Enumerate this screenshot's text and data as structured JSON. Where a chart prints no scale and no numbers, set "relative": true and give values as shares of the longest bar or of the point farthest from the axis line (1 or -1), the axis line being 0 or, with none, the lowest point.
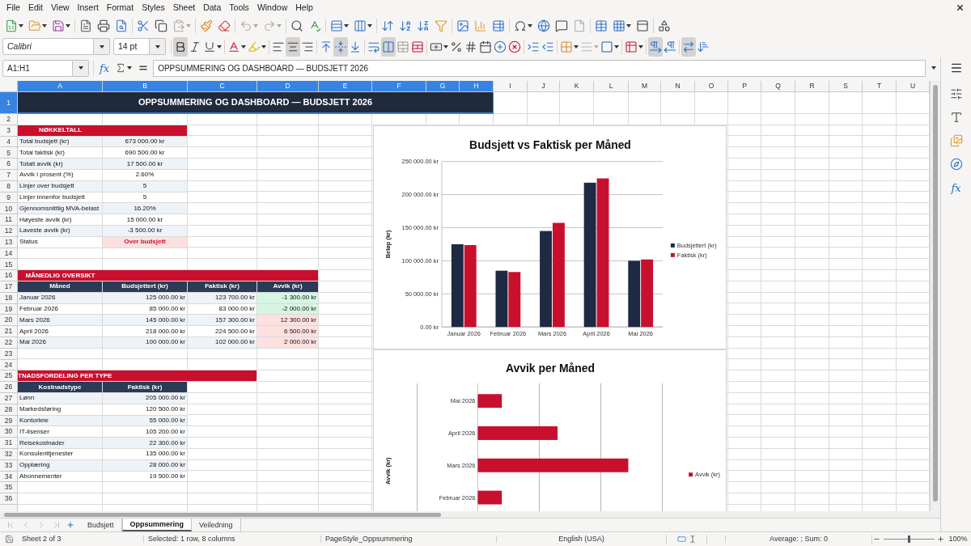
{
  "menu_bar": [
    "File",
    "Edit",
    "View",
    "Insert",
    "Format",
    "Styles",
    "Sheet",
    "Data",
    "Tools",
    "Window",
    "Help"
  ],
  "standard_toolbar": {
    "paste": {
      "disabled": true
    },
    "undo": {
      "disabled": true
    },
    "redo": {
      "disabled": true
    },
    "headers_footers": {
      "disabled": true
    }
  },
  "formatting_toolbar": {
    "font_name": "Calibri",
    "font_size": "14 pt",
    "bold": true,
    "italic": false,
    "underline": false,
    "align_left": false,
    "align_center": true,
    "align_right": false,
    "align_top": false,
    "align_middle": true,
    "align_bottom": false,
    "merge_and_center": true,
    "paragraph_left_to_right": true,
    "paragraph_right_to_left": false,
    "text_horizontal": true,
    "text_vertical": false
  },
  "formula_bar": {
    "name_box": "A1:H1",
    "function_symbol": "fx",
    "content": "OPPSUMMERING OG DASHBOARD — BUDSJETT 2026"
  },
  "sidebar": {
    "function_symbol": "fx"
  },
  "sheet": {
    "columns": [
      {
        "label": "A",
        "selected": true
      },
      {
        "label": "B",
        "selected": true
      },
      {
        "label": "C",
        "selected": true
      },
      {
        "label": "D",
        "selected": true
      },
      {
        "label": "E",
        "selected": true
      },
      {
        "label": "F",
        "selected": true
      },
      {
        "label": "G",
        "selected": true
      },
      {
        "label": "H",
        "selected": true
      },
      {
        "label": "I",
        "selected": false
      },
      {
        "label": "J",
        "selected": false
      },
      {
        "label": "K",
        "selected": false
      },
      {
        "label": "L",
        "selected": false
      },
      {
        "label": "M",
        "selected": false
      },
      {
        "label": "N",
        "selected": false
      },
      {
        "label": "O",
        "selected": false
      },
      {
        "label": "P",
        "selected": false
      },
      {
        "label": "Q",
        "selected": false
      },
      {
        "label": "R",
        "selected": false
      },
      {
        "label": "S",
        "selected": false
      },
      {
        "label": "T",
        "selected": false
      },
      {
        "label": "U",
        "selected": false
      }
    ],
    "rows": [
      {
        "label": "1",
        "selected": true
      },
      {
        "label": "2",
        "selected": false
      },
      {
        "label": "3",
        "selected": false
      },
      {
        "label": "4",
        "selected": false
      },
      {
        "label": "5",
        "selected": false
      },
      {
        "label": "6",
        "selected": false
      },
      {
        "label": "7",
        "selected": false
      },
      {
        "label": "8",
        "selected": false
      },
      {
        "label": "9",
        "selected": false
      },
      {
        "label": "10",
        "selected": false
      },
      {
        "label": "11",
        "selected": false
      },
      {
        "label": "12",
        "selected": false
      },
      {
        "label": "13",
        "selected": false
      },
      {
        "label": "14",
        "selected": false
      },
      {
        "label": "15",
        "selected": false
      },
      {
        "label": "16",
        "selected": false
      },
      {
        "label": "17",
        "selected": false
      },
      {
        "label": "18",
        "selected": false
      },
      {
        "label": "19",
        "selected": false
      },
      {
        "label": "20",
        "selected": false
      },
      {
        "label": "21",
        "selected": false
      },
      {
        "label": "22",
        "selected": false
      },
      {
        "label": "23",
        "selected": false
      },
      {
        "label": "24",
        "selected": false
      },
      {
        "label": "25",
        "selected": false
      },
      {
        "label": "26",
        "selected": false
      },
      {
        "label": "27",
        "selected": false
      },
      {
        "label": "28",
        "selected": false
      },
      {
        "label": "29",
        "selected": false
      },
      {
        "label": "30",
        "selected": false
      },
      {
        "label": "31",
        "selected": false
      },
      {
        "label": "32",
        "selected": false
      },
      {
        "label": "33",
        "selected": false
      },
      {
        "label": "34",
        "selected": false
      },
      {
        "label": "35",
        "selected": false
      },
      {
        "label": "36",
        "selected": false
      }
    ],
    "title": "OPPSUMMERING OG DASHBOARD — BUDSJETT 2026",
    "key_figures": {
      "heading": "NØKKELTALL",
      "rows": [
        {
          "label": "Total budsjett (kr)",
          "value": "673 000.00 kr",
          "kind": "number"
        },
        {
          "label": "Total faktisk (kr)",
          "value": "690 500.00 kr",
          "kind": "number"
        },
        {
          "label": "Totalt avvik (kr)",
          "value": "17 500.00 kr",
          "kind": "number"
        },
        {
          "label": "Avvik i prosent (%)",
          "value": "2.60%",
          "kind": "number"
        },
        {
          "label": "Linjer over budsjett",
          "value": "5",
          "kind": "number"
        },
        {
          "label": "Linjer innenfor budsjett",
          "value": "5",
          "kind": "number"
        },
        {
          "label": "Gjennomsnittlig MVA-belast",
          "value": "16.20%",
          "kind": "number"
        },
        {
          "label": "Høyeste avvik (kr)",
          "value": "15 000.00 kr",
          "kind": "number"
        },
        {
          "label": "Laveste avvik (kr)",
          "value": "-3 500.00 kr",
          "kind": "number"
        },
        {
          "label": "Status",
          "value": "Over budsjett",
          "kind": "status"
        }
      ]
    },
    "monthly_overview": {
      "heading": "MÅNEDLIG OVERSIKT",
      "columns": [
        "Måned",
        "Budsjettert (kr)",
        "Faktisk (kr)",
        "Avvik (kr)"
      ],
      "rows": [
        {
          "month": "Januar 2026",
          "budget": "125 000.00 kr",
          "actual": "123 700.00 kr",
          "deviation": "-1 300.00 kr",
          "over_budget": false
        },
        {
          "month": "Februar 2026",
          "budget": "85 000.00 kr",
          "actual": "83 000.00 kr",
          "deviation": "-2 000.00 kr",
          "over_budget": false
        },
        {
          "month": "Mars 2026",
          "budget": "145 000.00 kr",
          "actual": "157 300.00 kr",
          "deviation": "12 300.00 kr",
          "over_budget": true
        },
        {
          "month": "April 2026",
          "budget": "218 000.00 kr",
          "actual": "224 500.00 kr",
          "deviation": "6 500.00 kr",
          "over_budget": true
        },
        {
          "month": "Mai 2026",
          "budget": "100 000.00 kr",
          "actual": "102 000.00 kr",
          "deviation": "2 000.00 kr",
          "over_budget": true
        }
      ]
    },
    "cost_breakdown": {
      "heading": "TNADSFORDELING PER TYPE",
      "columns": [
        "Kostnadstype",
        "Faktisk (kr)"
      ],
      "rows": [
        {
          "type": "Lønn",
          "actual": "205 000.00 kr"
        },
        {
          "type": "Markedsføring",
          "actual": "120 500.00 kr"
        },
        {
          "type": "Kontorleie",
          "actual": "55 000.00 kr"
        },
        {
          "type": "IT-lisenser",
          "actual": "105 200.00 kr"
        },
        {
          "type": "Reisekostnader",
          "actual": "22 300.00 kr"
        },
        {
          "type": "Konsulenttjenester",
          "actual": "135 000.00 kr"
        },
        {
          "type": "Opplæring",
          "actual": "28 000.00 kr"
        },
        {
          "type": "Abonnementer",
          "actual": "19 500.00 kr"
        }
      ]
    },
    "charts": [
      {
        "chart_data": {
          "type": "bar",
          "orientation": "vertical",
          "title": "Budsjett vs Faktisk per Måned",
          "ylabel": "Beløp (kr)",
          "categories": [
            "Januar 2026",
            "Februar 2026",
            "Mars 2026",
            "April 2026",
            "Mai 2026"
          ],
          "series": [
            {
              "name": "Budsjettert (kr)",
              "color": "#1e2a44",
              "values": [
                125000,
                85000,
                145000,
                218000,
                100000
              ]
            },
            {
              "name": "Faktisk (kr)",
              "color": "#c8102e",
              "values": [
                123700,
                83000,
                157300,
                224500,
                102000
              ]
            }
          ],
          "ylim": [
            0,
            250000
          ],
          "yticks": [
            {
              "value": 0,
              "label": "0.00 kr"
            },
            {
              "value": 50000,
              "label": "50 000.00 kr"
            },
            {
              "value": 100000,
              "label": "100 000.00 kr"
            },
            {
              "value": 150000,
              "label": "150 000.00 kr"
            },
            {
              "value": 200000,
              "label": "200 000.00 kr"
            },
            {
              "value": 250000,
              "label": "250 000.00 kr"
            }
          ],
          "grid": true,
          "legend": "right"
        }
      },
      {
        "chart_data": {
          "type": "bar",
          "orientation": "horizontal",
          "title": "Avvik per Måned",
          "ylabel": "Avvik (kr)",
          "categories": [
            "Mai 2026",
            "April 2026",
            "Mars 2026",
            "Februar 2026"
          ],
          "series": [
            {
              "name": "Avvik (kr)",
              "color": "#c8102e",
              "values": [
                0.16,
                0.53,
                1,
                0.16
              ]
            }
          ],
          "relative": true,
          "legend": "right"
        }
      }
    ]
  },
  "sheet_tabs": [
    {
      "label": "Budsjett",
      "selected": false
    },
    {
      "label": "Oppsummering",
      "selected": true
    },
    {
      "label": "Veiledning",
      "selected": false
    }
  ],
  "status_bar": {
    "sheet_position": "Sheet 2 of 3",
    "selection": "Selected: 1 row, 8 columns",
    "page_style": "PageStyle_Oppsummering",
    "language": "English (USA)",
    "statistics": "Average: ; Sum: 0",
    "zoom": {
      "level": 0.5,
      "reading": "100%"
    }
  }
}
